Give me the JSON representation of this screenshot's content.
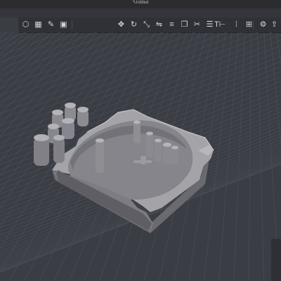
{
  "window": {
    "title": "*Untitled"
  },
  "toolbar": {
    "buttons": [
      {
        "name": "view-cube-icon",
        "glyph": "⬡"
      },
      {
        "name": "grid-icon",
        "glyph": "▦"
      },
      {
        "name": "sketch-icon",
        "glyph": "✎"
      },
      {
        "name": "image-icon",
        "glyph": "▣"
      },
      {
        "name": "move-icon",
        "glyph": "✥"
      },
      {
        "name": "rotate-icon",
        "glyph": "↻"
      },
      {
        "name": "scale-icon",
        "glyph": "⤡"
      },
      {
        "name": "mirror-icon",
        "glyph": "⇋"
      },
      {
        "name": "align-icon",
        "glyph": "≡"
      },
      {
        "name": "group-icon",
        "glyph": "❐"
      },
      {
        "name": "cut-icon",
        "glyph": "✂"
      },
      {
        "name": "layer-icon",
        "glyph": "☰"
      },
      {
        "name": "measure-icon",
        "glyph": "⊢"
      },
      {
        "name": "text-icon",
        "glyph": "T"
      },
      {
        "name": "pattern-icon",
        "glyph": "⁞"
      },
      {
        "name": "snap-icon",
        "glyph": "⊞"
      },
      {
        "name": "settings-icon",
        "glyph": "⚙"
      },
      {
        "name": "export-icon",
        "glyph": "⇪"
      }
    ]
  },
  "colors": {
    "viewport_bg": "#3a3d44",
    "grid_line": "#4d5057",
    "model_light": "#a9a9ae",
    "model_mid": "#8f8f94",
    "model_dark": "#6a6a70",
    "accent": "#3b82f6"
  }
}
